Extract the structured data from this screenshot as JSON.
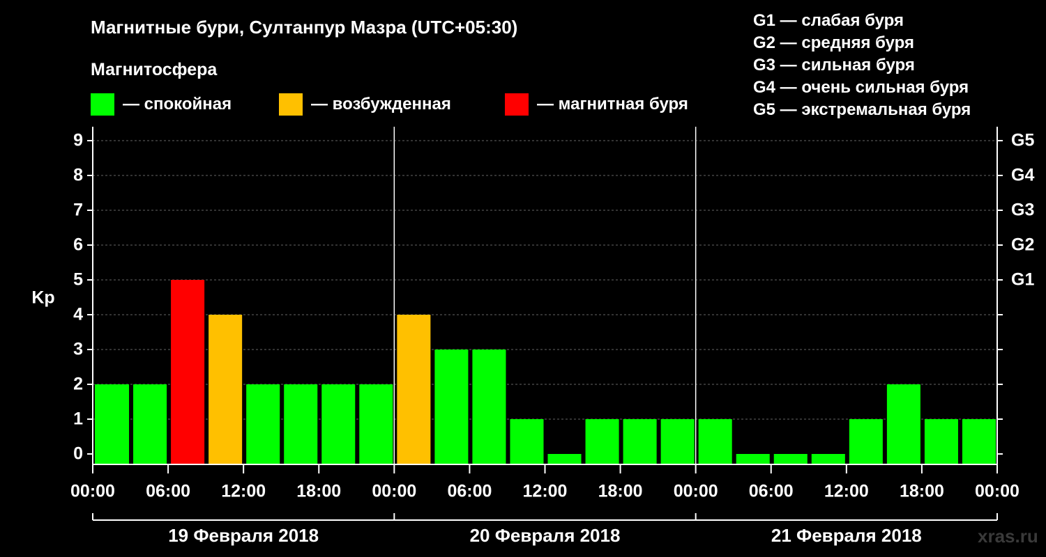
{
  "chart_data": {
    "type": "bar",
    "title": "Магнитные бури, Султанпур Мазра (UTC+05:30)",
    "subtitle": "Магнитосфера",
    "ylabel": "Kp",
    "ylim": [
      0,
      9
    ],
    "y_ticks": [
      "0",
      "1",
      "2",
      "3",
      "4",
      "5",
      "6",
      "7",
      "8",
      "9"
    ],
    "x_ticks": [
      "00:00",
      "06:00",
      "12:00",
      "18:00",
      "00:00",
      "06:00",
      "12:00",
      "18:00",
      "00:00",
      "06:00",
      "12:00",
      "18:00",
      "00:00"
    ],
    "days": [
      "19 Февраля 2018",
      "20 Февраля 2018",
      "21 Февраля 2018"
    ],
    "g_levels": [
      {
        "label": "G1",
        "kp": 5
      },
      {
        "label": "G2",
        "kp": 6
      },
      {
        "label": "G3",
        "kp": 7
      },
      {
        "label": "G4",
        "kp": 8
      },
      {
        "label": "G5",
        "kp": 9
      }
    ],
    "categories": [
      "19.02 00:00",
      "19.02 03:00",
      "19.02 06:00",
      "19.02 09:00",
      "19.02 12:00",
      "19.02 15:00",
      "19.02 18:00",
      "19.02 21:00",
      "20.02 00:00",
      "20.02 03:00",
      "20.02 06:00",
      "20.02 09:00",
      "20.02 12:00",
      "20.02 15:00",
      "20.02 18:00",
      "20.02 21:00",
      "21.02 00:00",
      "21.02 03:00",
      "21.02 06:00",
      "21.02 09:00",
      "21.02 12:00",
      "21.02 15:00",
      "21.02 18:00",
      "21.02 21:00"
    ],
    "values": [
      2,
      2,
      5,
      4,
      2,
      2,
      2,
      2,
      4,
      3,
      3,
      1,
      0,
      1,
      1,
      1,
      1,
      0,
      0,
      0,
      1,
      2,
      1,
      1
    ],
    "grid": "dashed horizontal at each Kp"
  },
  "legend": {
    "items": [
      {
        "label": "— спокойная",
        "color": "#00ff00"
      },
      {
        "label": "— возбужденная",
        "color": "#ffc000"
      },
      {
        "label": "— магнитная буря",
        "color": "#ff0000"
      }
    ],
    "g_descriptions": [
      "G1 — слабая буря",
      "G2 — средняя буря",
      "G3 — сильная буря",
      "G4 — очень сильная буря",
      "G5 — экстремальная буря"
    ]
  },
  "colors": {
    "quiet": "#00ff00",
    "active": "#ffc000",
    "storm": "#ff0000"
  },
  "watermark": "xras.ru"
}
